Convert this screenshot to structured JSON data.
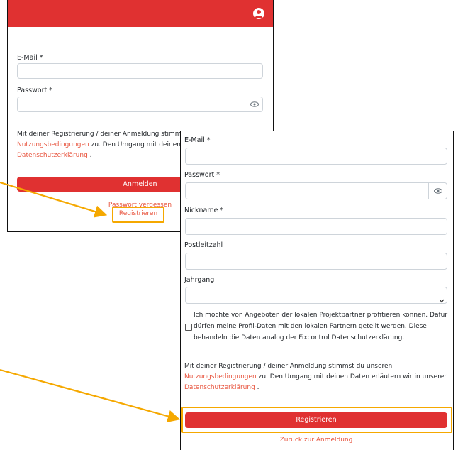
{
  "login": {
    "email_label": "E-Mail *",
    "password_label": "Passwort *",
    "consent_text": "Mit deiner Registrierung / deiner Anmeldung stimmst du",
    "terms_link": "Nutzungsbedingungen",
    "terms_after": " zu. Den Umgang mit deinen Daten",
    "privacy_link": "Datenschutzerklärung",
    "privacy_after": " .",
    "login_button": "Anmelden",
    "forgot_link": "Passwort vergessen",
    "register_link": "Registrieren",
    "icons": {
      "profile": "account-circle-icon",
      "visibility": "eye-icon"
    }
  },
  "register": {
    "email_label": "E-Mail *",
    "password_label": "Passwort *",
    "nickname_label": "Nickname *",
    "postcode_label": "Postleitzahl",
    "year_label": "Jahrgang",
    "partner_offer_text": "Ich möchte von Angeboten der lokalen Projektpartner profitieren können. Dafür dürfen meine Profil-Daten mit den lokalen Partnern geteilt werden. Diese behandeln die Daten analog der Fixcontrol Datenschutzerklärung.",
    "consent_text": "Mit deiner Registrierung / deiner Anmeldung stimmst du unseren",
    "terms_link": "Nutzungsbedingungen",
    "terms_after": " zu. Den Umgang mit deinen Daten erläutern wir in unserer",
    "privacy_link": "Datenschutzerklärung",
    "privacy_after": " .",
    "register_button": "Registrieren",
    "back_link": "Zurück zur Anmeldung",
    "icons": {
      "visibility": "eye-icon",
      "dropdown": "chevron-down-icon"
    }
  },
  "colors": {
    "brand_red": "#e03131",
    "link_red": "#e8553f",
    "highlight": "#f5a800"
  }
}
